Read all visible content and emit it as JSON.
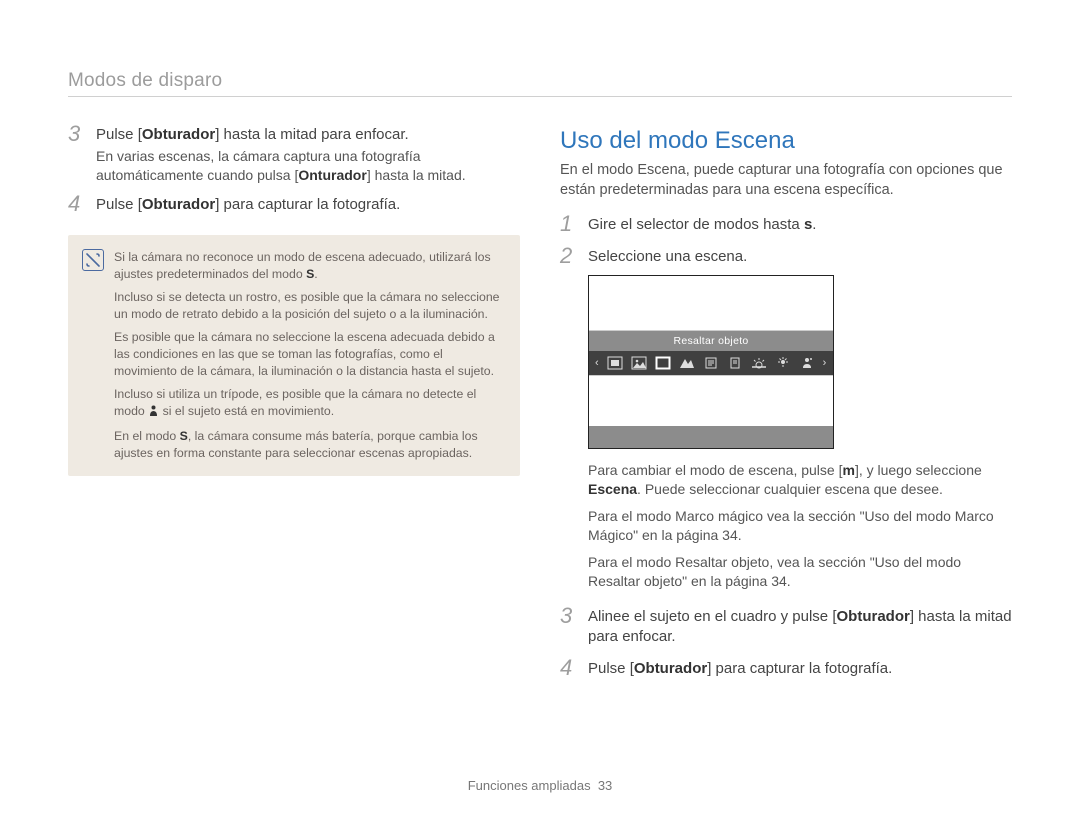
{
  "header": {
    "breadcrumb": "Modos de disparo"
  },
  "left": {
    "steps": [
      {
        "num": "3",
        "main_parts": [
          "Pulse [",
          "Obturador",
          "] hasta la mitad para enfocar."
        ],
        "sub_parts": [
          "En varias escenas, la cámara captura una fotografía automáticamente cuando pulsa [",
          "Onturador",
          "] hasta la mitad."
        ]
      },
      {
        "num": "4",
        "main_parts": [
          "Pulse [",
          "Obturador",
          "] para capturar la fotografía."
        ]
      }
    ],
    "note": {
      "icon_name": "note-icon",
      "items": [
        [
          "Si la cámara no reconoce un modo de escena adecuado, utilizará los ajustes predeterminados del modo ",
          {
            "bold": "S"
          },
          "."
        ],
        [
          "Incluso si se detecta un rostro, es posible que la cámara no seleccione un modo de retrato debido a la posición del sujeto o a la iluminación."
        ],
        [
          "Es posible que la cámara no seleccione la escena adecuada debido a las condiciones en las que se toman las fotografías, como el movimiento de la cámara, la iluminación o la distancia hasta el sujeto."
        ],
        [
          "Incluso si utiliza un trípode, es posible que la cámara no detecte el modo ",
          {
            "icon": "person-icon"
          },
          " si el sujeto está en movimiento."
        ],
        [
          "En el modo ",
          {
            "bold": "S"
          },
          ", la cámara consume más batería, porque cambia los ajustes en forma constante para seleccionar escenas apropiadas."
        ]
      ]
    }
  },
  "right": {
    "title": "Uso del modo Escena",
    "intro": "En el modo Escena, puede capturar una fotografía con opciones que están predeterminadas para una escena específica.",
    "steps12": [
      {
        "num": "1",
        "main_parts": [
          "Gire el selector de modos hasta ",
          {
            "bold": "s"
          },
          "."
        ]
      },
      {
        "num": "2",
        "main_parts": [
          "Seleccione una escena."
        ]
      }
    ],
    "screen": {
      "label": "Resaltar objeto",
      "icons": [
        "frame-icon",
        "picture-icon",
        "square-icon",
        "mountain-icon",
        "text-icon",
        "document-icon",
        "sunset-icon",
        "lamp-icon",
        "person-dark-icon"
      ],
      "selected_index": 2
    },
    "bullets": [
      [
        "Para cambiar el modo de escena, pulse [",
        {
          "bold": "m"
        },
        "], y luego seleccione ",
        {
          "bold": "Escena"
        },
        ". Puede seleccionar cualquier escena que desee."
      ],
      [
        "Para el modo Marco mágico vea la sección \"Uso del modo Marco Mágico\" en la página 34."
      ],
      [
        "Para el modo Resaltar objeto, vea la sección \"Uso del modo Resaltar objeto\" en la página 34."
      ]
    ],
    "steps34": [
      {
        "num": "3",
        "main_parts": [
          "Alinee el sujeto en el cuadro y pulse [",
          "Obturador",
          "] hasta la mitad para enfocar."
        ]
      },
      {
        "num": "4",
        "main_parts": [
          "Pulse [",
          "Obturador",
          "] para capturar la fotografía."
        ]
      }
    ]
  },
  "footer": {
    "section": "Funciones ampliadas",
    "page": "33"
  }
}
